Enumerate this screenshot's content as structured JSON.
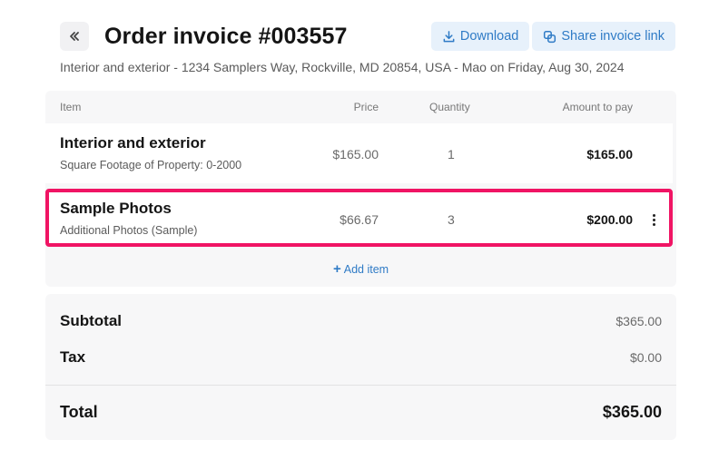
{
  "header": {
    "title": "Order invoice #003557",
    "download_label": "Download",
    "share_label": "Share invoice link"
  },
  "subtitle": "Interior and exterior - 1234 Samplers Way, Rockville, MD 20854, USA - Mao on Friday, Aug 30, 2024",
  "table": {
    "columns": {
      "item": "Item",
      "price": "Price",
      "quantity": "Quantity",
      "amount": "Amount to pay"
    },
    "rows": [
      {
        "name": "Interior and exterior",
        "desc": "Square Footage of Property: 0-2000",
        "price": "$165.00",
        "qty": "1",
        "amount": "$165.00"
      },
      {
        "name": "Sample Photos",
        "desc": "Additional Photos (Sample)",
        "price": "$66.67",
        "qty": "3",
        "amount": "$200.00"
      }
    ],
    "add_item_label": "Add item"
  },
  "totals": {
    "subtotal_label": "Subtotal",
    "subtotal_value": "$365.00",
    "tax_label": "Tax",
    "tax_value": "$0.00",
    "total_label": "Total",
    "total_value": "$365.00"
  },
  "colors": {
    "accent": "#2f7bc6",
    "highlight": "#f01464"
  },
  "icons": {
    "back": "double-chevron-left-icon",
    "download": "download-icon",
    "share": "copy-link-icon",
    "more": "more-vertical-icon",
    "add": "plus-icon"
  }
}
